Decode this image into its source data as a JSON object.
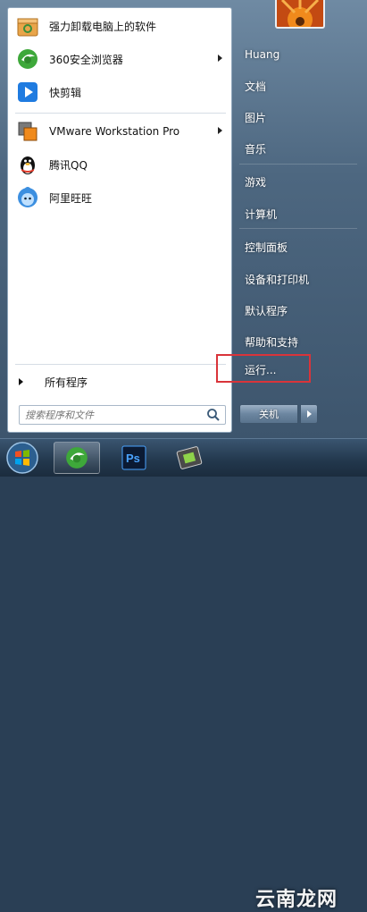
{
  "programs": [
    {
      "label": "强力卸载电脑上的软件",
      "icon": "uninstaller-box-icon",
      "has_submenu": false
    },
    {
      "label": "360安全浏览器",
      "icon": "360-browser-icon",
      "has_submenu": true
    },
    {
      "label": "快剪辑",
      "icon": "video-editor-play-icon",
      "has_submenu": false
    },
    {
      "label": "VMware Workstation Pro",
      "icon": "vmware-icon",
      "has_submenu": true
    },
    {
      "label": "腾讯QQ",
      "icon": "qq-penguin-icon",
      "has_submenu": false
    },
    {
      "label": "阿里旺旺",
      "icon": "aliwangwang-icon",
      "has_submenu": false
    }
  ],
  "all_programs_label": "所有程序",
  "search": {
    "placeholder": "搜索程序和文件"
  },
  "right_items": {
    "user": "Huang",
    "documents": "文档",
    "pictures": "图片",
    "music": "音乐",
    "games": "游戏",
    "computer": "计算机",
    "control_panel": "控制面板",
    "devices_printers": "设备和打印机",
    "default_programs": "默认程序",
    "help_support": "帮助和支持",
    "run": "运行..."
  },
  "shutdown_label": "关机",
  "watermark": "云南龙网",
  "colors": {
    "highlight_border": "#d9343a",
    "panel_blue": "#4d6780"
  }
}
